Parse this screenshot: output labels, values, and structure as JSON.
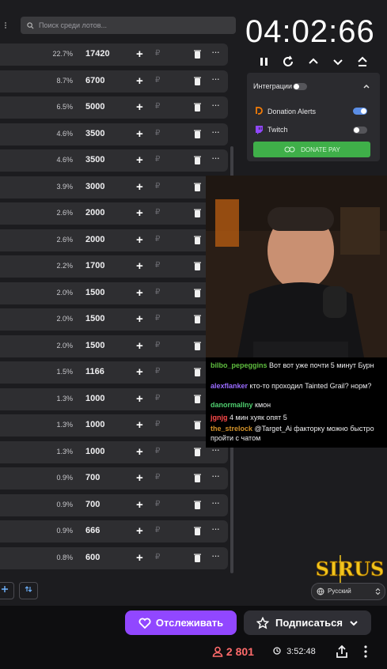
{
  "search": {
    "placeholder": "Поиск среди лотов..."
  },
  "lots": [
    {
      "pct": "22.7%",
      "amount": "17420"
    },
    {
      "pct": "8.7%",
      "amount": "6700"
    },
    {
      "pct": "6.5%",
      "amount": "5000"
    },
    {
      "pct": "4.6%",
      "amount": "3500"
    },
    {
      "pct": "4.6%",
      "amount": "3500"
    },
    {
      "pct": "3.9%",
      "amount": "3000"
    },
    {
      "pct": "2.6%",
      "amount": "2000"
    },
    {
      "pct": "2.6%",
      "amount": "2000"
    },
    {
      "pct": "2.2%",
      "amount": "1700"
    },
    {
      "pct": "2.0%",
      "amount": "1500"
    },
    {
      "pct": "2.0%",
      "amount": "1500"
    },
    {
      "pct": "2.0%",
      "amount": "1500"
    },
    {
      "pct": "1.5%",
      "amount": "1166"
    },
    {
      "pct": "1.3%",
      "amount": "1000"
    },
    {
      "pct": "1.3%",
      "amount": "1000"
    },
    {
      "pct": "1.3%",
      "amount": "1000"
    },
    {
      "pct": "0.9%",
      "amount": "700"
    },
    {
      "pct": "0.9%",
      "amount": "700"
    },
    {
      "pct": "0.9%",
      "amount": "666"
    },
    {
      "pct": "0.8%",
      "amount": "600"
    }
  ],
  "lot_symbols": {
    "plus": "+",
    "currency": "₽",
    "more": "···"
  },
  "timer": "04:02:66",
  "integrations": {
    "title": "Интеграции",
    "enabled": false,
    "items": [
      {
        "name": "Donation Alerts",
        "enabled": true,
        "color": "#f57d07"
      },
      {
        "name": "Twitch",
        "enabled": false,
        "color": "#9147ff"
      }
    ],
    "donate_button": "DONATE PAY"
  },
  "chat": [
    {
      "user": "bilbo_pepeggins",
      "color": "#5fbf3f",
      "text": "Вот вот уже почти 5 минут Бурн"
    },
    {
      "user": "alexflanker",
      "color": "#9a6bff",
      "text": "кто-то проходил Tainted Grail? норм?"
    },
    {
      "user": "danormallny",
      "color": "#4fcf6f",
      "text": "кмон"
    },
    {
      "user": "jgnjg",
      "color": "#ff4a4a",
      "text": "4 мин хуяк опят 5"
    },
    {
      "user": "the_strelock",
      "color": "#d2922a",
      "text": "@Target_Ai факторку можно быстро пройти с чатом"
    }
  ],
  "overlay_logo": "SIRUS",
  "language": "Русский",
  "actions": {
    "follow": "Отслеживать",
    "subscribe": "Подписаться"
  },
  "stats": {
    "viewers": "2 801",
    "uptime": "3:52:48"
  },
  "colors": {
    "accent": "#9147ff",
    "donate": "#3faf49",
    "viewers": "#ff6b6b"
  }
}
